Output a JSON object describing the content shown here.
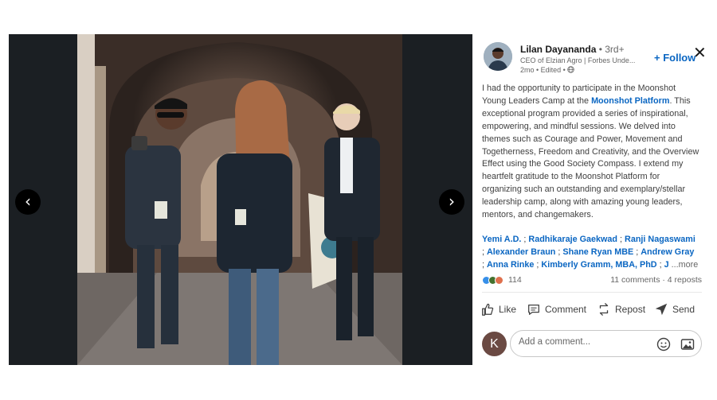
{
  "author": {
    "name": "Lilan Dayananda",
    "degree": " • 3rd+",
    "headline": "CEO of Elzian Agro | Forbes Unde...",
    "meta": "2mo • Edited • ",
    "follow_label": "+ Follow"
  },
  "post": {
    "text_before": "I had the opportunity to participate in the Moonshot Young Leaders Camp at the ",
    "link": "Moonshot Platform",
    "text_after": ". This exceptional program provided a series of inspirational, empowering, and mindful sessions. We delved into themes such as Courage and Power, Movement and Togetherness, Freedom and Creativity, and the Overview Effect using the Good Society Compass. I extend my heartfelt gratitude to the Moonshot Platform for organizing such an outstanding and exemplary/stellar leadership camp, along with amazing young leaders, mentors, and changemakers.",
    "tags": [
      "Yemi A.D.",
      "Radhikaraje Gaekwad",
      "Ranji Nagaswami",
      "Alexander Braun",
      "Shane Ryan MBE",
      "Andrew Gray",
      "Anna Rinke",
      "Kimberly Gramm, MBA, PhD",
      "J"
    ],
    "more_label": "...more"
  },
  "social": {
    "reaction_count": "114",
    "stats": "11 comments · 4 reposts",
    "reaction_colors": [
      "#378fe9",
      "#44712e",
      "#df704d"
    ]
  },
  "actions": {
    "like": "Like",
    "comment": "Comment",
    "repost": "Repost",
    "send": "Send"
  },
  "comment_box": {
    "avatar_letter": "K",
    "placeholder": "Add a comment..."
  },
  "icons": {
    "close": "close-icon",
    "prev": "chevron-left-icon",
    "next": "chevron-right-icon",
    "globe": "globe-icon",
    "emoji": "emoji-icon",
    "image": "image-icon"
  },
  "colors": {
    "link": "#0a66c2",
    "media_bg": "#1b1f23"
  }
}
